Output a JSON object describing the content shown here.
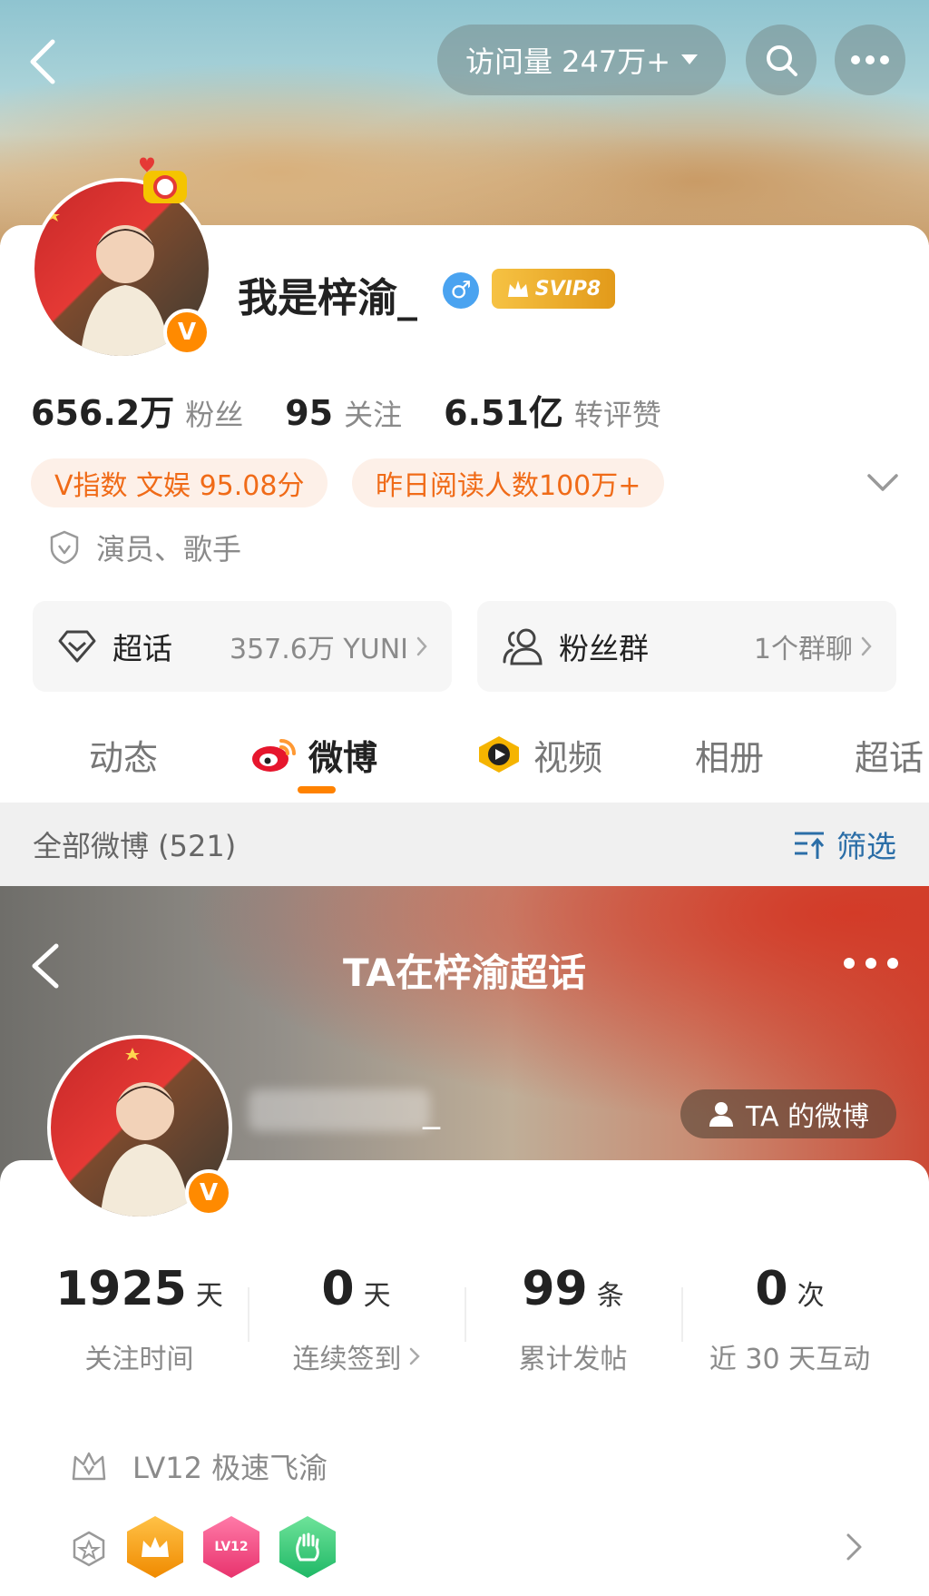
{
  "header": {
    "visit_label": "访问量 247万+",
    "search_icon": "search-icon",
    "more_icon": "more-icon"
  },
  "profile": {
    "username": "我是梓渝_",
    "gender_symbol": "♂",
    "svip_label": "SVIP8",
    "verified_letter": "V",
    "stats": [
      {
        "num": "656.2万",
        "label": "粉丝"
      },
      {
        "num": "95",
        "label": "关注"
      },
      {
        "num": "6.51亿",
        "label": "转评赞"
      }
    ],
    "tags": [
      "V指数 文娱 95.08分",
      "昨日阅读人数100万+"
    ],
    "identity": "演员、歌手"
  },
  "quick": {
    "supertopic_title": "超话",
    "supertopic_meta": "357.6万 YUNI",
    "fangroup_title": "粉丝群",
    "fangroup_meta": "1个群聊"
  },
  "tabs": [
    {
      "label": "动态"
    },
    {
      "label": "微博"
    },
    {
      "label": "视频"
    },
    {
      "label": "相册"
    },
    {
      "label": "超话"
    }
  ],
  "filter": {
    "all_label": "全部微博 (521)",
    "filter_label": "筛选"
  },
  "supertopic": {
    "title": "TA在梓渝超话",
    "name_suffix": "_",
    "ta_weibo": "TA 的微博",
    "metrics": [
      {
        "num": "1925",
        "unit": "天",
        "label": "关注时间"
      },
      {
        "num": "0",
        "unit": "天",
        "label": "连续签到"
      },
      {
        "num": "99",
        "unit": "条",
        "label": "累计发帖"
      },
      {
        "num": "0",
        "unit": "次",
        "label": "近 30 天互动"
      }
    ],
    "level": "LV12 极速飞渝",
    "badge_lv_text": "LV12"
  },
  "colors": {
    "accent_orange": "#ff8200",
    "tag_text": "#f06b18",
    "link_blue": "#2b6ea7"
  }
}
